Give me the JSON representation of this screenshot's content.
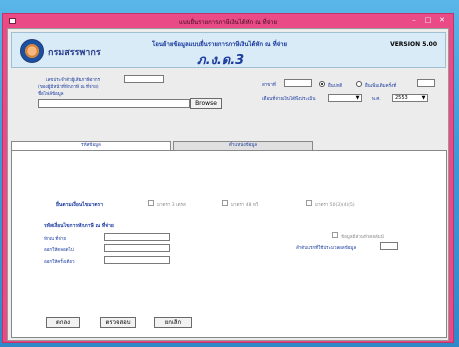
{
  "window": {
    "title": "แบบยื่นรายการภาษีเงินได้หัก ณ ที่จ่าย"
  },
  "header": {
    "department": "กรมสรรพากร",
    "subtitle": "โอนย้ายข้อมูลแบบยื่นรายการภาษีเงินได้หัก ณ ที่จ่าย",
    "form_code": "ภ.ง.ด.3",
    "version": "VERSION 5.00"
  },
  "form": {
    "taxid_label": "เลขประจำตัวผู้เสียภาษีอากร",
    "taxid_note": "(ของผู้มีหน้าที่หักภาษี ณ ที่จ่าย)",
    "branch_label": "สาขาที่",
    "filetype_label": "ชื่อไฟล์ข้อมูล",
    "radio_regular_label": "ยื่นปกติ",
    "radio_additional_label": "ยื่นเพิ่มเติมครั้งที่",
    "browse_label": "Browse",
    "period_label": "เดือนที่จ่ายเงินได้พึงประเมิน",
    "month_value": "",
    "year_label": "พ.ศ.",
    "year_value": "2553"
  },
  "tabs": [
    {
      "label": "รหัสข้อมูล"
    },
    {
      "label": "ตำแหน่งข้อมูล"
    }
  ],
  "panel": {
    "condition_label": "ยื่นตามเงื่อนไขมาตรา",
    "section_3tredecim": "มาตรา 3 เตรส",
    "section_48_3": "มาตรา 48 ทวิ",
    "section_50bis": "มาตรา 50(3)(4)(5)",
    "withholding_title": "รหัสเงื่อนไขการหักภาษี ณ ที่จ่าย",
    "withhold_label": "หักณ ที่จ่าย",
    "pay_always_label": "ออกให้ตลอดไป",
    "pay_once_label": "ออกให้ครั้งเดียว",
    "has_header_label": "ข้อมูลมีส่วนหัวคอลัมน์",
    "start_row_label": "ลำดับแรกที่ใช้ประมวลผลข้อมูล"
  },
  "buttons": {
    "ok": "ตกลง",
    "check": "ตรวจสอบ",
    "cancel": "ยกเลิก"
  }
}
